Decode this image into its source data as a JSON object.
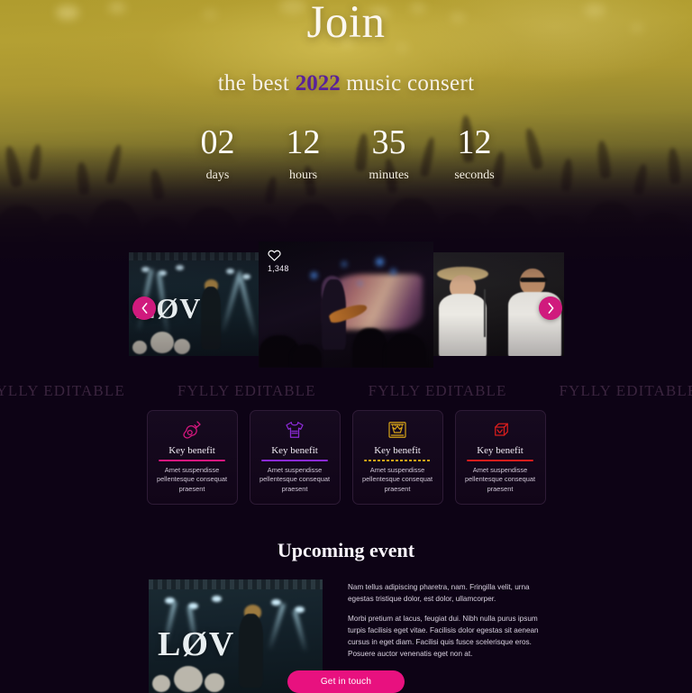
{
  "hero": {
    "title": "Join",
    "subtitle_before": "the best ",
    "subtitle_year": "2022",
    "subtitle_after": " music consert"
  },
  "countdown": {
    "units": [
      {
        "value": "02",
        "label": "days"
      },
      {
        "value": "12",
        "label": "hours"
      },
      {
        "value": "35",
        "label": "minutes"
      },
      {
        "value": "12",
        "label": "seconds"
      }
    ]
  },
  "carousel": {
    "prev_icon": "chevron-left-icon",
    "next_icon": "chevron-right-icon",
    "like_icon": "heart-icon",
    "like_count": "1,348",
    "accent_color": "#d01a7d",
    "slides": [
      {
        "name": "slide-lov-stage",
        "caption_text": "LØV"
      },
      {
        "name": "slide-guitarist",
        "caption_text": ""
      },
      {
        "name": "slide-hat-performer",
        "caption_text": ""
      }
    ]
  },
  "marquee": {
    "text": "FYLLY EDITABLE",
    "repeat": 7,
    "color": "#3c2640"
  },
  "benefits": [
    {
      "icon": "guitar-icon",
      "title": "Key benefit",
      "text": "Amet suspendisse pellentesque consequat praesent",
      "color": "#d6177f"
    },
    {
      "icon": "tshirt-icon",
      "title": "Key benefit",
      "text": "Amet suspendisse pellentesque consequat praesent",
      "color": "#8b2ad6"
    },
    {
      "icon": "ticket-crown-icon",
      "title": "Key benefit",
      "text": "Amet suspendisse pellentesque consequat praesent",
      "color": "#d6a318"
    },
    {
      "icon": "drum-icon",
      "title": "Key benefit",
      "text": "Amet suspendisse pellentesque consequat praesent",
      "color": "#d61d1d"
    }
  ],
  "upcoming": {
    "title": "Upcoming event",
    "photo_caption": "LØV",
    "paragraph_1": "Nam tellus adipiscing pharetra, nam. Fringilla velit, urna egestas tristique dolor, est dolor, ullamcorper.",
    "paragraph_2": "Morbi pretium at lacus, feugiat dui. Nibh nulla purus ipsum turpis facilisis eget vitae. Facilisis dolor egestas sit aenean cursus in eget diam. Facilisi quis fusce scelerisque eros. Posuere auctor venenatis eget non at.",
    "cta_label": "Get in touch",
    "cta_color": "#e8117f"
  }
}
